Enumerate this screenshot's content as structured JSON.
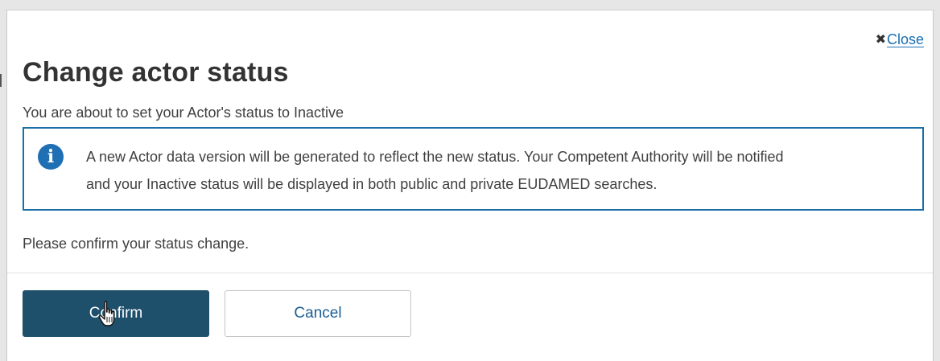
{
  "dialog": {
    "close_label": "Close",
    "title": "Change actor status",
    "subtitle": "You are about to set your Actor's status to Inactive",
    "info_message_line1": "A new Actor data version will be generated to reflect the new status. Your Competent Authority will be notified",
    "info_message_line2": "and your Inactive status will be displayed in both public and private EUDAMED searches.",
    "confirm_prompt": "Please confirm your status change.",
    "confirm_label": "Confirm",
    "cancel_label": "Cancel"
  },
  "icons": {
    "close": "close-icon",
    "info": "info-icon",
    "cursor": "hand-pointer-icon"
  },
  "colors": {
    "primary_button": "#1e4f6b",
    "link": "#1a6fb3",
    "info_border": "#1a6fa8",
    "info_icon": "#1f6fb4"
  }
}
